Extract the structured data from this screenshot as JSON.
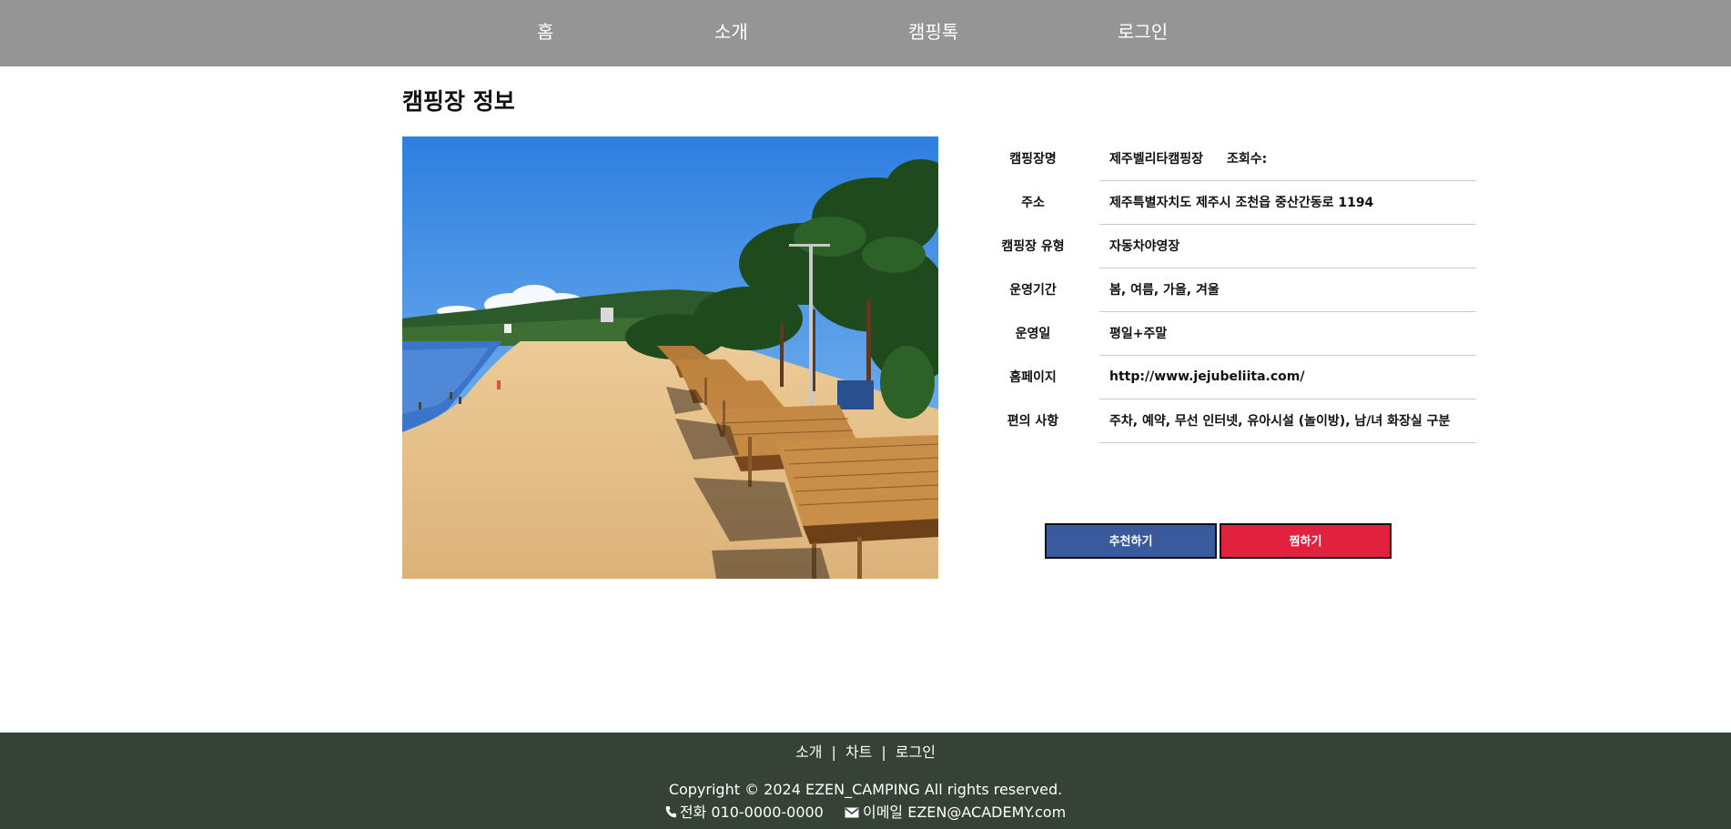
{
  "nav": {
    "items": [
      {
        "label": "홈"
      },
      {
        "label": "소개"
      },
      {
        "label": "캠핑톡"
      },
      {
        "label": "로그인"
      }
    ]
  },
  "page": {
    "title": "캠핑장 정보"
  },
  "photo": {
    "alt": "beach-campsite-photo",
    "colors": {
      "sky": "#3f8fe4",
      "sand": "#e6c08a",
      "shelter": "#b47a3a",
      "trees": "#1f4a1e"
    }
  },
  "info": {
    "name_label": "캠핑장명",
    "name_value": "제주벨리타캠핑장",
    "views_label": "조회수:",
    "views_value": "",
    "rows": [
      {
        "label": "주소",
        "value": "제주특별자치도 제주시 조천읍 중산간동로 1194"
      },
      {
        "label": "캠핑장 유형",
        "value": "자동차야영장"
      },
      {
        "label": "운영기간",
        "value": "봄, 여름, 가을, 겨울"
      },
      {
        "label": "운영일",
        "value": "평일+주말"
      },
      {
        "label": "홈페이지",
        "value": "http://www.jejubeliita.com/"
      },
      {
        "label": "편의 사항",
        "value": "주차, 예약, 무선 인터넷, 유아시설 (놀이방), 남/녀 화장실 구분"
      }
    ]
  },
  "buttons": {
    "recommend_label": "추천하기",
    "favorite_label": "찜하기",
    "recommend_color": "#3a5a9e",
    "favorite_color": "#e2213f"
  },
  "footer": {
    "links": [
      {
        "label": "소개"
      },
      {
        "label": "차트"
      },
      {
        "label": "로그인"
      }
    ],
    "separator": "|",
    "copyright": "Copyright © 2024 EZEN_CAMPING All rights reserved.",
    "phone": "전화 010-0000-0000",
    "email": "이메일 EZEN@ACADEMY.com",
    "background": "#364236"
  }
}
